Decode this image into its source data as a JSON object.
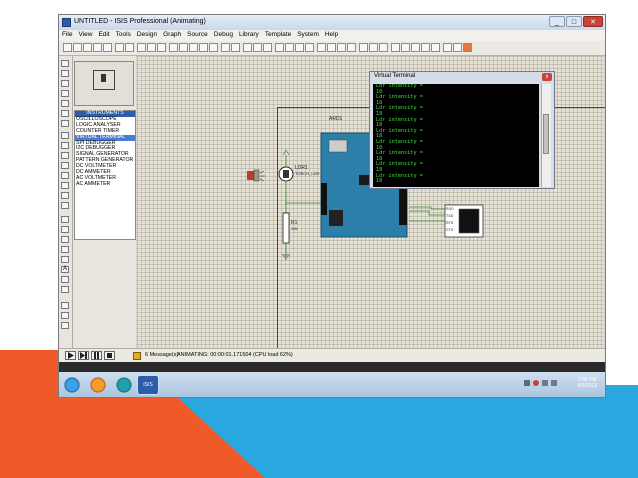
{
  "window": {
    "title": "UNTITLED - ISIS Professional (Animating)",
    "minimize_glyph": "_",
    "maximize_glyph": "□",
    "close_glyph": "✕"
  },
  "menubar": {
    "items": [
      "File",
      "View",
      "Edit",
      "Tools",
      "Design",
      "Graph",
      "Source",
      "Debug",
      "Library",
      "Template",
      "System",
      "Help"
    ]
  },
  "left_toolbar_letter": "A",
  "instruments": {
    "header": "INSTRUMENTS",
    "items": [
      "OSCILLOSCOPE",
      "LOGIC ANALYSER",
      "COUNTER TIMER",
      "VIRTUAL TERMINAL",
      "SPI DEBUGGER",
      "I2C DEBUGGER",
      "SIGNAL GENERATOR",
      "PATTERN GENERATOR",
      "DC VOLTMETER",
      "DC AMMETER",
      "AC VOLTMETER",
      "AC AMMETER"
    ],
    "selected_index": 3
  },
  "schematic": {
    "arduino_label": "ARD1",
    "ldr_label": "LDR1",
    "ldr_value": "TORCH_LDR",
    "resistor_label": "R1",
    "resistor_value": "10k",
    "terminal_pins": [
      "RXD",
      "TXD",
      "RTS",
      "CTS"
    ]
  },
  "virtual_terminal": {
    "title": "Virtual Terminal",
    "close_glyph": "x",
    "lines": [
      "Ldr intensity =",
      "18",
      "Ldr intensity =",
      "18",
      "Ldr intensity =",
      "18",
      "Ldr intensity =",
      "18",
      "Ldr intensity =",
      "18",
      "Ldr intensity =",
      "18",
      "Ldr intensity =",
      "18",
      "Ldr intensity =",
      "18",
      "Ldr intensity =",
      "18"
    ]
  },
  "statusbar": {
    "messages": "6 Message(s)",
    "animating": "ANIMATING: 00:00:01.171504 (CPU load 62%)"
  },
  "taskbar": {
    "clock_time": "7:48 PM",
    "clock_date": "4/5/2013",
    "isis_label": "ISIS"
  },
  "colors": {
    "slide_orange": "#f05a28",
    "slide_blue": "#29a8e0",
    "terminal_text": "#38e038",
    "arduino_board": "#2c7fa8",
    "sheet_border": "#3a3aa0"
  }
}
